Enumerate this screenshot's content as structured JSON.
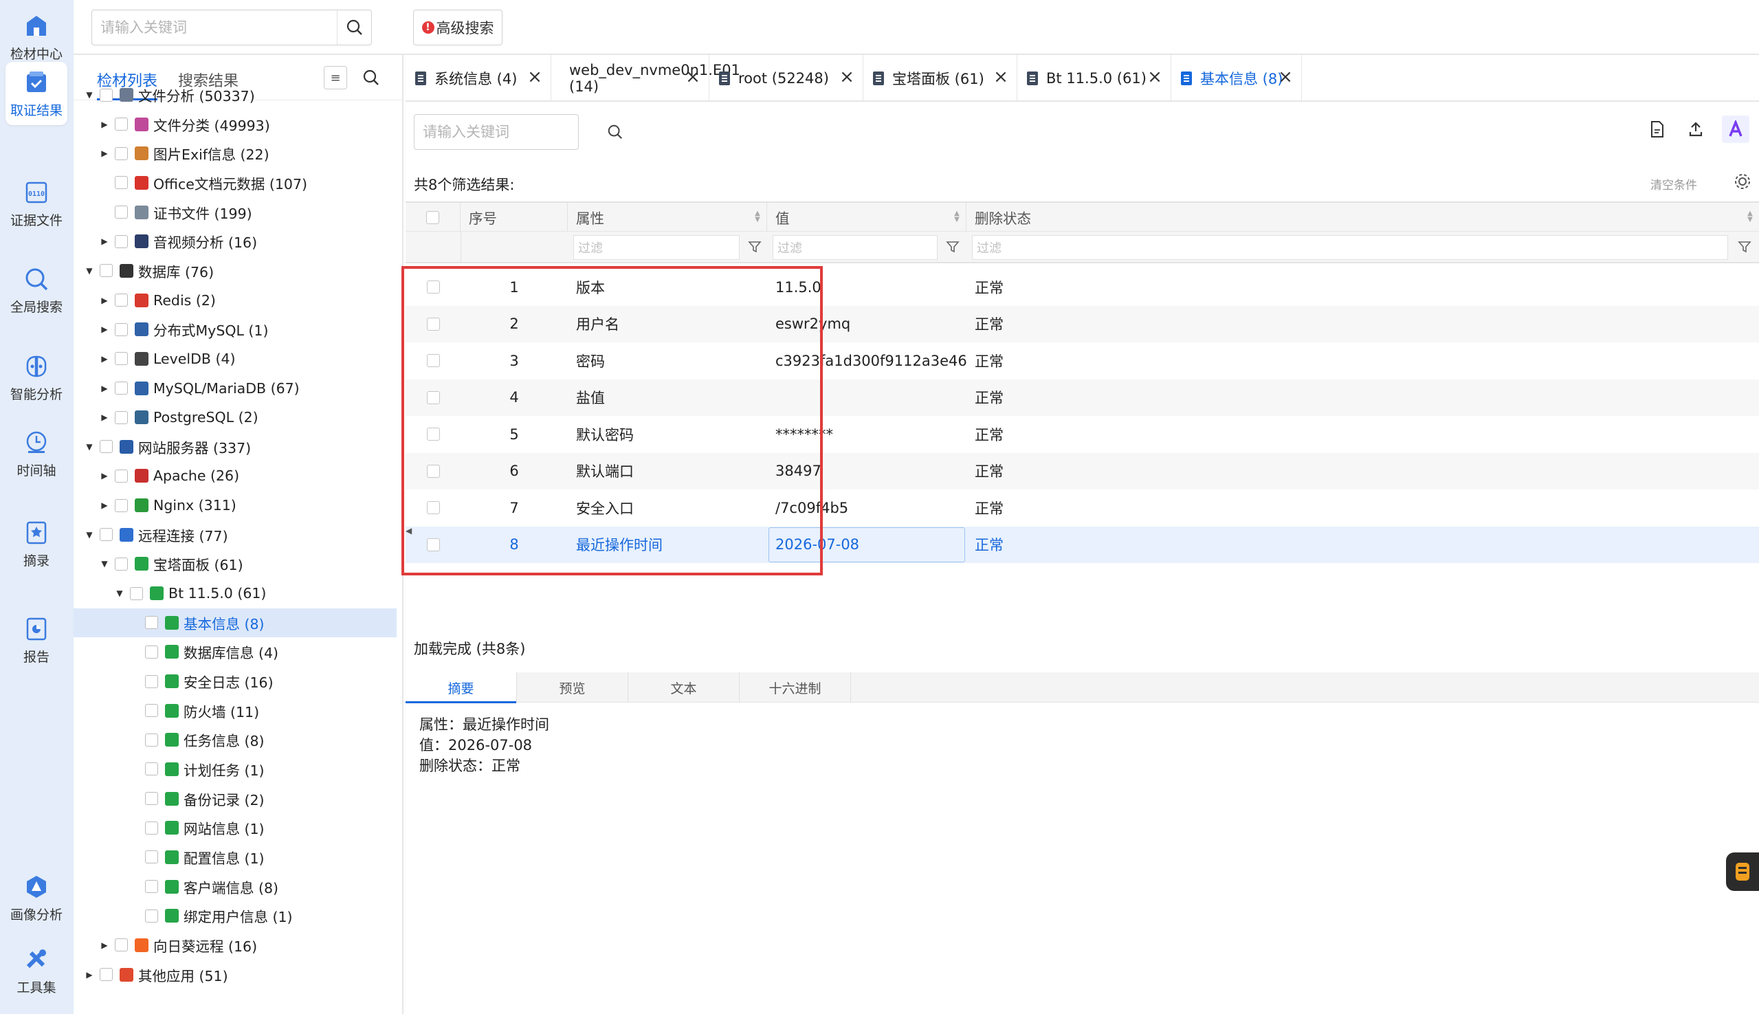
{
  "rail": {
    "items": [
      {
        "label": "检材中心",
        "icon": "home-icon"
      },
      {
        "label": "取证结果",
        "icon": "evidence-result-icon",
        "active": true
      },
      {
        "label": "证据文件",
        "icon": "binary-file-icon"
      },
      {
        "label": "全局搜索",
        "icon": "global-search-icon"
      },
      {
        "label": "智能分析",
        "icon": "brain-icon"
      },
      {
        "label": "时间轴",
        "icon": "clock-icon"
      },
      {
        "label": "摘录",
        "icon": "bookmark-star-icon"
      },
      {
        "label": "报告",
        "icon": "report-icon"
      },
      {
        "label": "画像分析",
        "icon": "profile-analysis-icon"
      },
      {
        "label": "工具集",
        "icon": "tools-icon"
      }
    ]
  },
  "topbar": {
    "search_placeholder": "请输入关键词",
    "advanced_search": "高级搜索",
    "advanced_mark": "!"
  },
  "tree_panel": {
    "tabs": [
      "检材列表",
      "搜索结果"
    ],
    "active_tab": 0,
    "items": [
      {
        "label": "文件分析 (50337)",
        "level": 0,
        "expand": "open",
        "icon": "file-analysis-icon"
      },
      {
        "label": "文件分类 (49993)",
        "level": 1,
        "expand": "closed",
        "icon": "file-category-icon"
      },
      {
        "label": "图片Exif信息 (22)",
        "level": 1,
        "expand": "closed",
        "icon": "image-exif-icon"
      },
      {
        "label": "Office文档元数据 (107)",
        "level": 1,
        "expand": "none",
        "icon": "office-icon"
      },
      {
        "label": "证书文件 (199)",
        "level": 1,
        "expand": "none",
        "icon": "certificate-icon"
      },
      {
        "label": "音视频分析 (16)",
        "level": 1,
        "expand": "closed",
        "icon": "media-icon"
      },
      {
        "label": "数据库 (76)",
        "level": 0,
        "expand": "open",
        "icon": "database-icon"
      },
      {
        "label": "Redis (2)",
        "level": 1,
        "expand": "closed",
        "icon": "redis-icon"
      },
      {
        "label": "分布式MySQL (1)",
        "level": 1,
        "expand": "closed",
        "icon": "mysql-icon"
      },
      {
        "label": "LevelDB (4)",
        "level": 1,
        "expand": "closed",
        "icon": "leveldb-icon"
      },
      {
        "label": "MySQL/MariaDB (67)",
        "level": 1,
        "expand": "closed",
        "icon": "mysql-icon"
      },
      {
        "label": "PostgreSQL (2)",
        "level": 1,
        "expand": "closed",
        "icon": "postgresql-icon"
      },
      {
        "label": "网站服务器 (337)",
        "level": 0,
        "expand": "open",
        "icon": "web-server-icon"
      },
      {
        "label": "Apache (26)",
        "level": 1,
        "expand": "closed",
        "icon": "apache-icon"
      },
      {
        "label": "Nginx (311)",
        "level": 1,
        "expand": "closed",
        "icon": "nginx-icon"
      },
      {
        "label": "远程连接 (77)",
        "level": 0,
        "expand": "open",
        "icon": "remote-connection-icon"
      },
      {
        "label": "宝塔面板 (61)",
        "level": 1,
        "expand": "open",
        "icon": "bt-panel-icon"
      },
      {
        "label": "Bt 11.5.0 (61)",
        "level": 2,
        "expand": "open",
        "icon": "bt-panel-icon"
      },
      {
        "label": "基本信息 (8)",
        "level": 3,
        "expand": "none",
        "icon": "bt-panel-icon",
        "selected": true
      },
      {
        "label": "数据库信息 (4)",
        "level": 3,
        "expand": "none",
        "icon": "bt-panel-icon"
      },
      {
        "label": "安全日志 (16)",
        "level": 3,
        "expand": "none",
        "icon": "bt-panel-icon"
      },
      {
        "label": "防火墙 (11)",
        "level": 3,
        "expand": "none",
        "icon": "bt-panel-icon"
      },
      {
        "label": "任务信息 (8)",
        "level": 3,
        "expand": "none",
        "icon": "bt-panel-icon"
      },
      {
        "label": "计划任务 (1)",
        "level": 3,
        "expand": "none",
        "icon": "bt-panel-icon"
      },
      {
        "label": "备份记录 (2)",
        "level": 3,
        "expand": "none",
        "icon": "bt-panel-icon"
      },
      {
        "label": "网站信息 (1)",
        "level": 3,
        "expand": "none",
        "icon": "bt-panel-icon"
      },
      {
        "label": "配置信息 (1)",
        "level": 3,
        "expand": "none",
        "icon": "bt-panel-icon"
      },
      {
        "label": "客户端信息 (8)",
        "level": 3,
        "expand": "none",
        "icon": "bt-panel-icon"
      },
      {
        "label": "绑定用户信息 (1)",
        "level": 3,
        "expand": "none",
        "icon": "bt-panel-icon"
      },
      {
        "label": "向日葵远程 (16)",
        "level": 1,
        "expand": "closed",
        "icon": "sunlogin-icon"
      },
      {
        "label": "其他应用 (51)",
        "level": 0,
        "expand": "closed",
        "icon": "other-apps-icon"
      }
    ]
  },
  "tabs": [
    {
      "label": "系统信息 (4)"
    },
    {
      "label": "web_dev_nvme0n1.E01 (14)"
    },
    {
      "label": "root (52248)"
    },
    {
      "label": "宝塔面板 (61)"
    },
    {
      "label": "Bt 11.5.0 (61)"
    },
    {
      "label": "基本信息 (8)",
      "active": true
    }
  ],
  "content": {
    "search_placeholder": "请输入关键词",
    "result_count": "共8个筛选结果:",
    "clear_conditions": "清空条件",
    "columns": [
      "序号",
      "属性",
      "值",
      "删除状态"
    ],
    "filter_placeholder": "过滤",
    "rows": [
      {
        "no": "1",
        "attr": "版本",
        "value": "11.5.0",
        "status": "正常"
      },
      {
        "no": "2",
        "attr": "用户名",
        "value": "eswr2ymq",
        "status": "正常"
      },
      {
        "no": "3",
        "attr": "密码",
        "value": "c3923fa1d300f9112a3e46...",
        "status": "正常"
      },
      {
        "no": "4",
        "attr": "盐值",
        "value": "",
        "status": "正常"
      },
      {
        "no": "5",
        "attr": "默认密码",
        "value": "********",
        "status": "正常"
      },
      {
        "no": "6",
        "attr": "默认端口",
        "value": "38497",
        "status": "正常"
      },
      {
        "no": "7",
        "attr": "安全入口",
        "value": "/7c09f4b5",
        "status": "正常"
      },
      {
        "no": "8",
        "attr": "最近操作时间",
        "value": "2026-07-08",
        "status": "正常",
        "selected": true
      }
    ],
    "load_status": "加载完成 (共8条)",
    "sub_tabs": [
      "摘要",
      "预览",
      "文本",
      "十六进制"
    ],
    "active_sub_tab": 0,
    "detail": {
      "line1": "属性：最近操作时间",
      "line2": "值：2026-07-08",
      "line3": "删除状态：正常"
    }
  },
  "colors": {
    "accent": "#1668dc",
    "highlight_box": "#e03b3b",
    "rail_bg": "#e4edf9"
  }
}
